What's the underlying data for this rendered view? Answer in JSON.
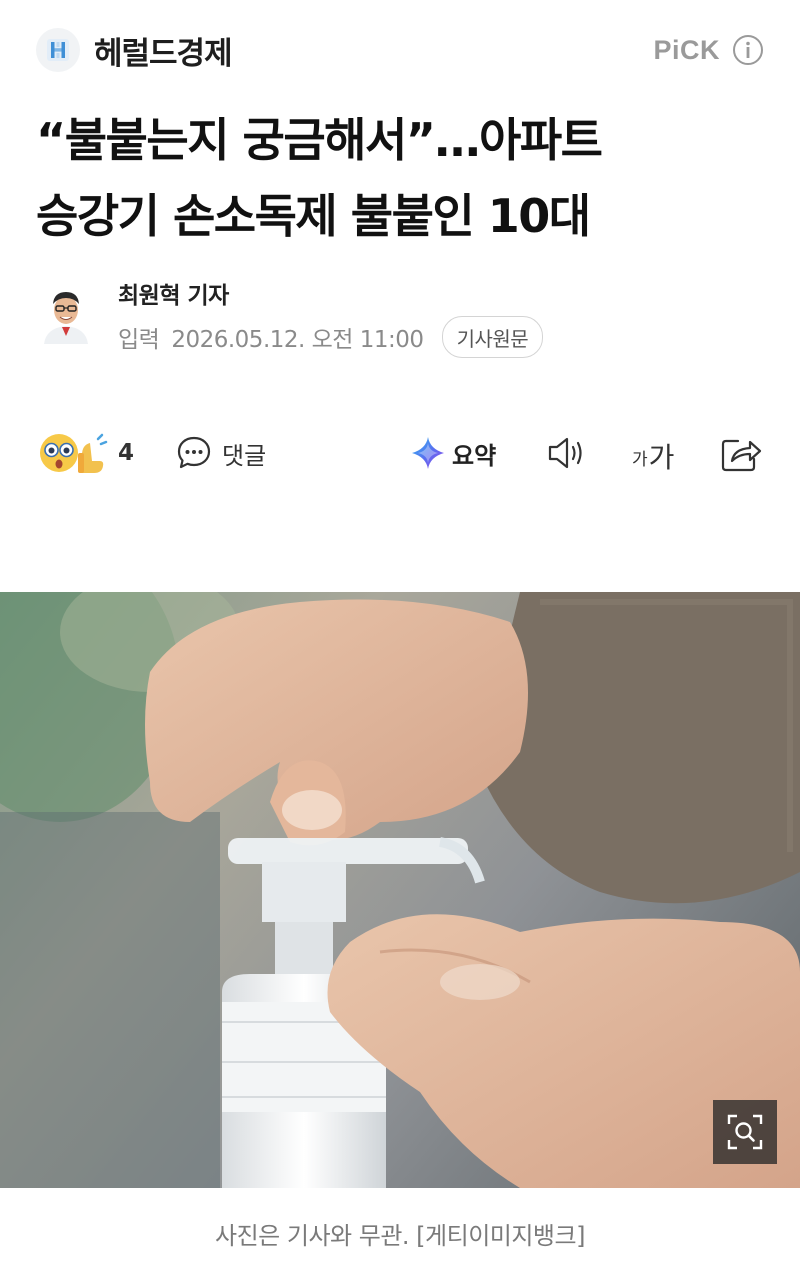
{
  "press": {
    "name": "헤럴드경제",
    "pick_label": "PiCK"
  },
  "headline": {
    "line1": "“불붙는지 궁금해서”…아파트",
    "line2": "승강기 손소독제 불붙인 10대"
  },
  "byline": {
    "reporter": "최원혁 기자",
    "date_label": "입력",
    "date_value": "2026.05.12. 오전 11:00",
    "original_button": "기사원문"
  },
  "actions": {
    "reaction_count": "4",
    "comment_label": "댓글",
    "summary_label": "요약",
    "font_small": "가",
    "font_big": "가"
  },
  "photo": {
    "caption": "사진은 기사와 무관. [게티이미지뱅크]"
  },
  "colors": {
    "text_primary": "#111111",
    "text_muted": "#8a8a8a",
    "pick_gray": "#9a9a9a",
    "logo_blue": "#3f8fd6",
    "summary_purple": "#5b6cf0"
  },
  "icons": {
    "press_logo": "press-logo-icon",
    "info": "info-icon",
    "reaction": "surprised-emoji-icon",
    "comment": "speech-bubble-icon",
    "summary": "sparkle-icon",
    "tts": "speaker-icon",
    "share": "share-icon",
    "zoom": "zoom-icon"
  }
}
